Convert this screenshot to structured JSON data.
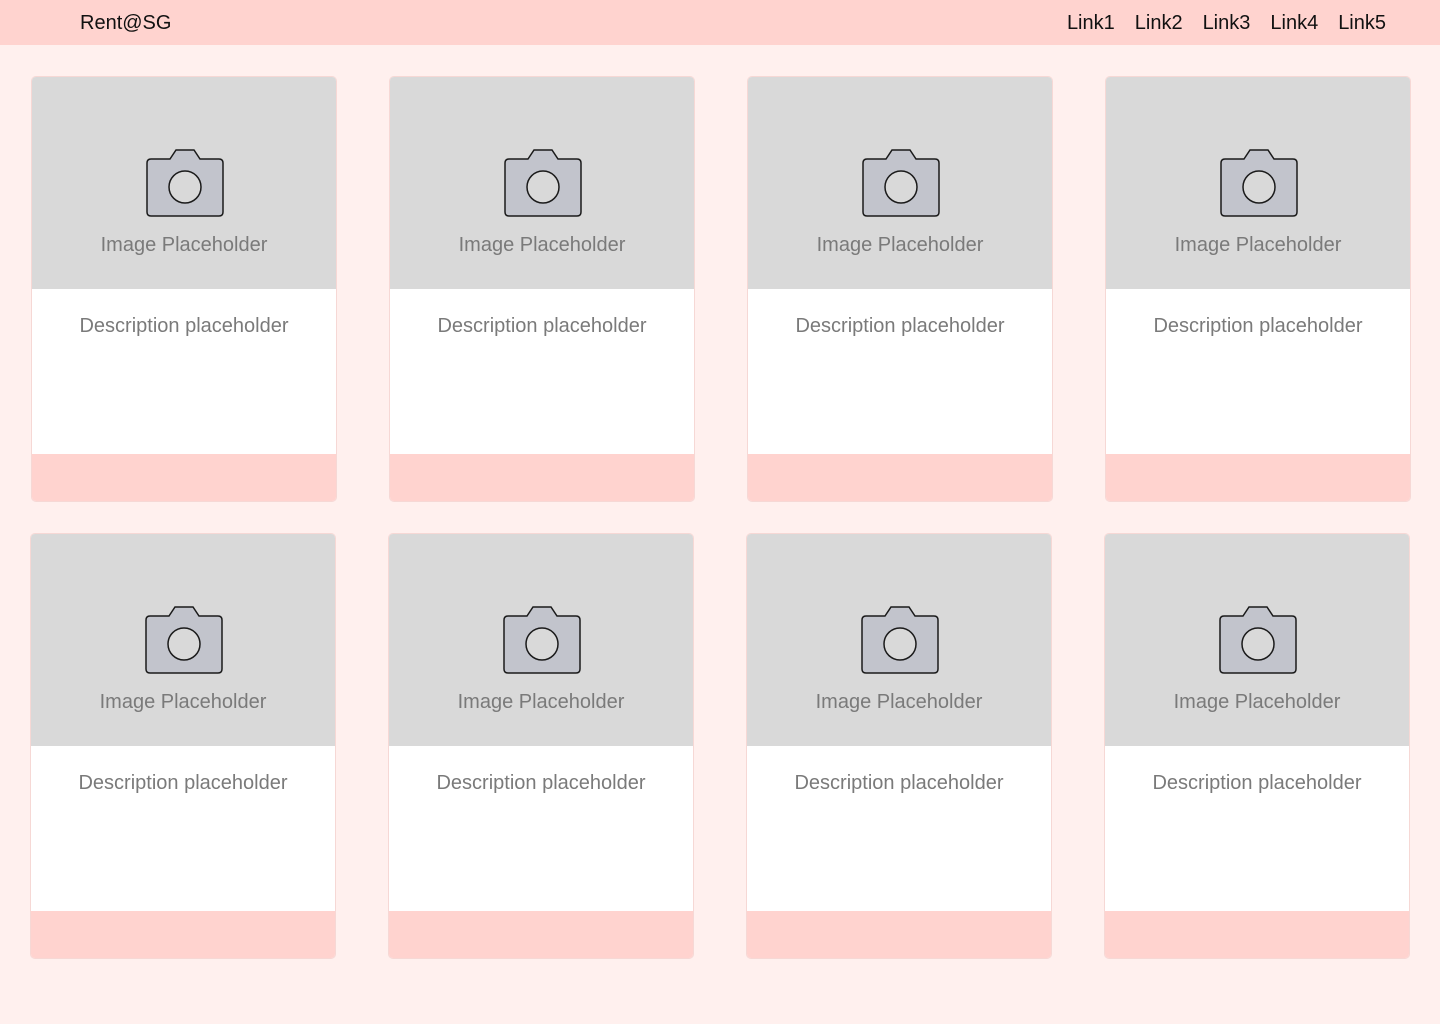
{
  "header": {
    "brand": "Rent@SG",
    "links": [
      "Link1",
      "Link2",
      "Link3",
      "Link4",
      "Link5"
    ]
  },
  "cards": [
    {
      "image_label": "Image Placeholder",
      "description": "Description placeholder"
    },
    {
      "image_label": "Image Placeholder",
      "description": "Description placeholder"
    },
    {
      "image_label": "Image Placeholder",
      "description": "Description placeholder"
    },
    {
      "image_label": "Image Placeholder",
      "description": "Description placeholder"
    },
    {
      "image_label": "Image Placeholder",
      "description": "Description placeholder"
    },
    {
      "image_label": "Image Placeholder",
      "description": "Description placeholder"
    },
    {
      "image_label": "Image Placeholder",
      "description": "Description placeholder"
    },
    {
      "image_label": "Image Placeholder",
      "description": "Description placeholder"
    }
  ],
  "colors": {
    "page_background": "#fff0ee",
    "accent": "#ffd3cf",
    "placeholder_gray": "#d9d9d9",
    "text_muted": "#7a7a7a"
  },
  "icons": {
    "card_image": "camera-icon"
  }
}
